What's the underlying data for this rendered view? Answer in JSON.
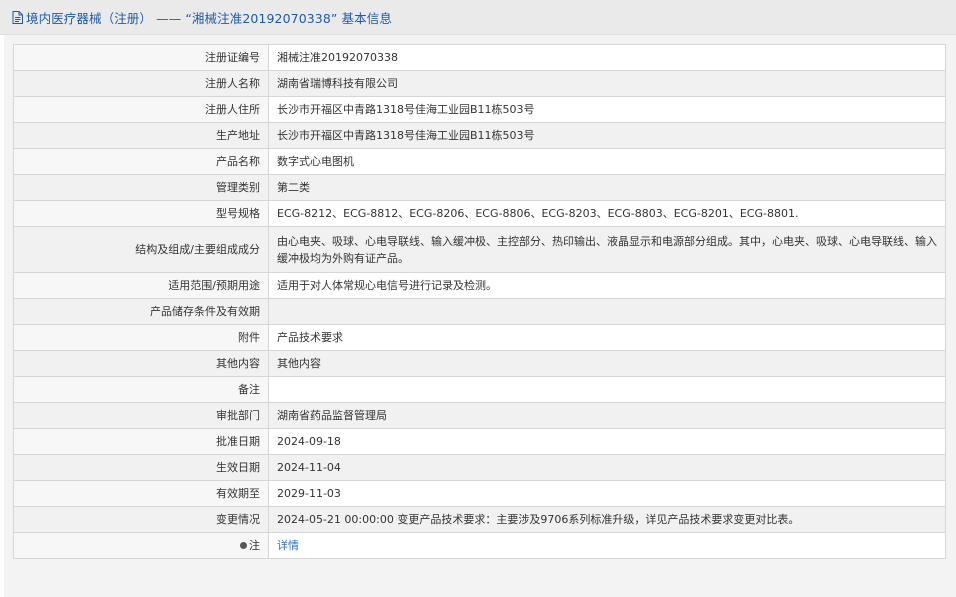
{
  "header": {
    "title": "境内医疗器械（注册） —— “湘械注准20192070338” 基本信息",
    "icon": "document-icon"
  },
  "rows": [
    {
      "label": "注册证编号",
      "value": "湘械注准20192070338"
    },
    {
      "label": "注册人名称",
      "value": "湖南省瑞博科技有限公司"
    },
    {
      "label": "注册人住所",
      "value": "长沙市开福区中青路1318号佳海工业园B11栋503号"
    },
    {
      "label": "生产地址",
      "value": "长沙市开福区中青路1318号佳海工业园B11栋503号"
    },
    {
      "label": "产品名称",
      "value": "数字式心电图机"
    },
    {
      "label": "管理类别",
      "value": "第二类"
    },
    {
      "label": "型号规格",
      "value": "ECG-8212、ECG-8812、ECG-8206、ECG-8806、ECG-8203、ECG-8803、ECG-8201、ECG-8801."
    },
    {
      "label": "结构及组成/主要组成成分",
      "value": "由心电夹、吸球、心电导联线、输入缓冲极、主控部分、热印输出、液晶显示和电源部分组成。其中，心电夹、吸球、心电导联线、输入缓冲极均为外购有证产品。"
    },
    {
      "label": "适用范围/预期用途",
      "value": "适用于对人体常规心电信号进行记录及检测。"
    },
    {
      "label": "产品储存条件及有效期",
      "value": ""
    },
    {
      "label": "附件",
      "value": "产品技术要求"
    },
    {
      "label": "其他内容",
      "value": "其他内容"
    },
    {
      "label": "备注",
      "value": ""
    },
    {
      "label": "审批部门",
      "value": "湖南省药品监督管理局"
    },
    {
      "label": "批准日期",
      "value": "2024-09-18"
    },
    {
      "label": "生效日期",
      "value": "2024-11-04"
    },
    {
      "label": "有效期至",
      "value": "2029-11-03"
    },
    {
      "label": "变更情况",
      "value": "2024-05-21 00:00:00 变更产品技术要求：主要涉及9706系列标准升级，详见产品技术要求变更对比表。"
    },
    {
      "label": "注",
      "value": "详情",
      "icon": "info-dot-icon"
    }
  ],
  "colors": {
    "header_bg": "#eaeaea",
    "title": "#1e5aa8",
    "link": "#2f6fbe",
    "border": "#d6d6d6",
    "label_bg": "#f7f7f7"
  }
}
